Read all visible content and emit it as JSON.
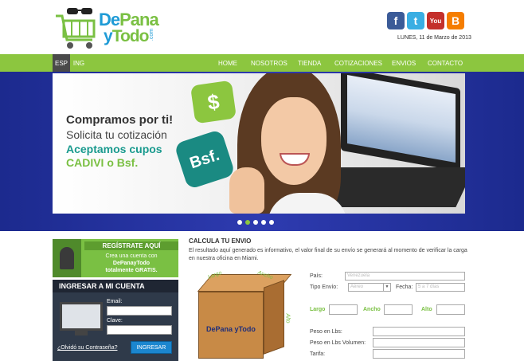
{
  "header": {
    "logo_line1_a": "De",
    "logo_line1_b": "Pana",
    "logo_line2_a": "y",
    "logo_line2_b": "Todo",
    "logo_com": ".com",
    "social": {
      "facebook": "f",
      "twitter": "t",
      "youtube": "You",
      "blogger": "B"
    },
    "date": "LUNES, 11 de Marzo de 2013"
  },
  "nav": {
    "lang_esp": "ESP",
    "lang_ing": "ING",
    "items": [
      "HOME",
      "NOSOTROS",
      "TIENDA",
      "COTIZACIONES",
      "ENVIOS",
      "CONTACTO"
    ]
  },
  "slider": {
    "line1": "Compramos por ti!",
    "line2": "Solicita tu cotización",
    "line3": "Aceptamos cupos",
    "line4": "CADIVI o Bsf.",
    "bubble1": "$",
    "bubble2": "Bsf.",
    "active_dot": 2
  },
  "register": {
    "title": "REGÍSTRATE AQUÍ",
    "text_line1": "Crea una cuenta con",
    "text_line2": "DePanayTodo",
    "text_line3": "totalmente GRATIS."
  },
  "login": {
    "title": "INGRESAR A MI CUENTA",
    "email_label": "Email:",
    "password_label": "Clave:",
    "forgot": "¿Olvidó su Contraseña?",
    "button": "INGRESAR"
  },
  "calculator": {
    "title": "CALCULA TU ENVIO",
    "description": "El resultado aquí generado es informativo, el valor final de su envío se generará al momento de verificar la carga en nuestra oficina en Miami.",
    "box_labels": {
      "largo": "Largo",
      "ancho": "Ancho",
      "alto": "Alto"
    },
    "box_logo": "DePana yTodo",
    "pais_label": "País:",
    "pais_placeholder": "Venezuela",
    "tipo_envio_label": "Tipo Envío:",
    "tipo_envio_value": "Aéreo",
    "fecha_label": "Fecha:",
    "fecha_placeholder": "5 a 7 días",
    "largo_label": "Largo",
    "ancho_label": "Ancho",
    "alto_label": "Alto",
    "peso_lbs_label": "Peso en Lbs:",
    "peso_vol_label": "Peso en Lbs Volumen:",
    "tarifa_label": "Tarifa:"
  },
  "colors": {
    "green": "#8cc63f",
    "blue": "#1f9bd6",
    "dark_blue": "#1c2a8e",
    "teal": "#199a8e"
  }
}
